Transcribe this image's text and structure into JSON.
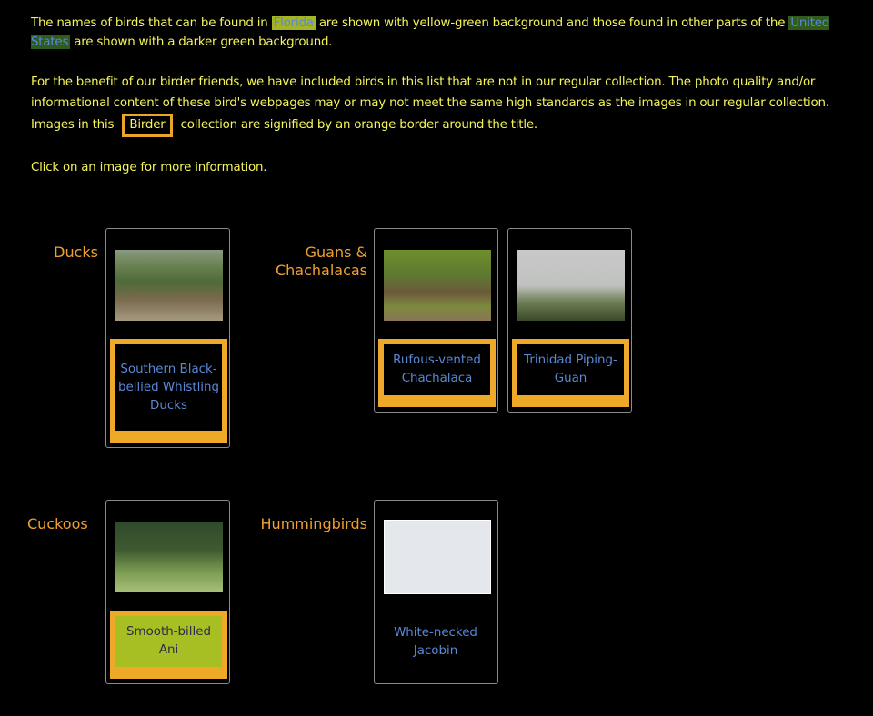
{
  "intro": {
    "p1_a": "The names of birds that can be found in ",
    "florida": "Florida",
    "p1_b": " are shown with yellow-green background and those found in other parts of the ",
    "us": "United States",
    "p1_c": " are shown with a darker green background.",
    "p2_a": "For the benefit of our birder friends, we have included birds in this list that are not in our regular collection. The photo quality and/or informational content of these bird's webpages may or may not meet the same high standards as the images in our regular collection.   Images in this ",
    "birder": "Birder",
    "p2_b": " collection are signified by an orange border around the title.",
    "p3": "Click on an image for more information."
  },
  "colors": {
    "text": "#f4f45a",
    "heading": "#f0a030",
    "name": "#5a88d6",
    "birder_border": "#eea928",
    "florida_bg": "#a8bf24",
    "us_bg": "#2f5c1c"
  },
  "categories": [
    {
      "name": "Ducks",
      "birds": [
        {
          "name": "Southern Black-bellied Whistling Ducks",
          "birder": true
        }
      ]
    },
    {
      "name": "Guans & Chachalacas",
      "birds": [
        {
          "name": "Rufous-vented Chachalaca",
          "birder": true
        },
        {
          "name": "Trinidad Piping-Guan",
          "birder": true
        }
      ]
    },
    {
      "name": "Cuckoos",
      "birds": [
        {
          "name": "Smooth-billed Ani",
          "birder": true,
          "florida": true
        }
      ]
    },
    {
      "name": "Hummingbirds",
      "birds": [
        {
          "name": "White-necked Jacobin",
          "birder": false
        }
      ]
    }
  ]
}
